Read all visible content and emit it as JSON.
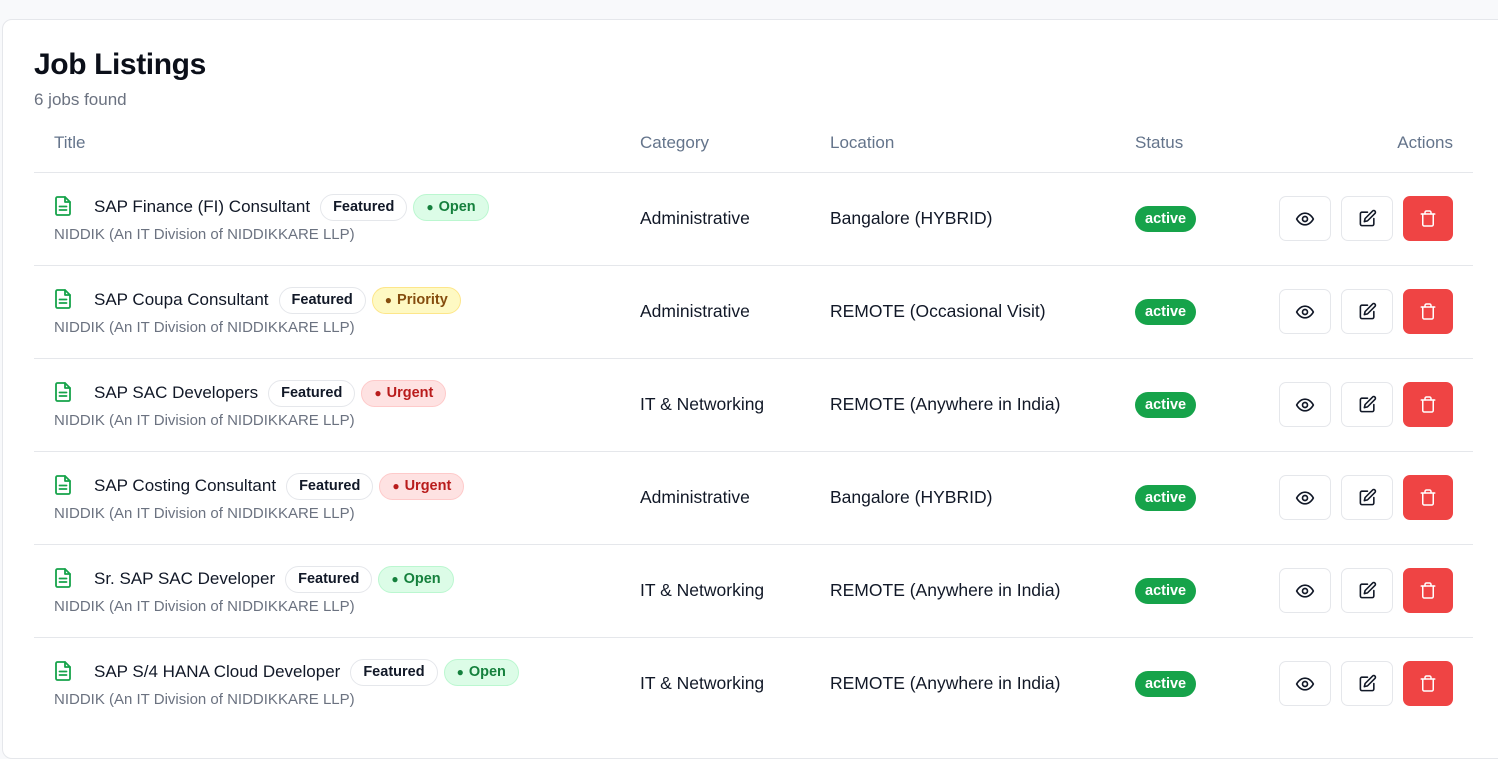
{
  "header": {
    "title": "Job Listings",
    "subtitle": "6 jobs found"
  },
  "columns": {
    "title": "Title",
    "category": "Category",
    "location": "Location",
    "status": "Status",
    "actions": "Actions"
  },
  "colors": {
    "status_active": "#16a34a",
    "delete_button": "#ef4444",
    "doc_icon": "#16a34a"
  },
  "jobs": [
    {
      "title": "SAP Finance (FI) Consultant",
      "featured": "Featured",
      "tag": {
        "label": "Open",
        "kind": "open"
      },
      "company": "NIDDIK (An IT Division of NIDDIKKARE LLP)",
      "category": "Administrative",
      "location": "Bangalore (HYBRID)",
      "status": "active"
    },
    {
      "title": "SAP Coupa Consultant",
      "featured": "Featured",
      "tag": {
        "label": "Priority",
        "kind": "priority"
      },
      "company": "NIDDIK (An IT Division of NIDDIKKARE LLP)",
      "category": "Administrative",
      "location": "REMOTE (Occasional Visit)",
      "status": "active"
    },
    {
      "title": "SAP SAC Developers",
      "featured": "Featured",
      "tag": {
        "label": "Urgent",
        "kind": "urgent"
      },
      "company": "NIDDIK (An IT Division of NIDDIKKARE LLP)",
      "category": "IT & Networking",
      "location": "REMOTE (Anywhere in India)",
      "status": "active"
    },
    {
      "title": "SAP Costing Consultant",
      "featured": "Featured",
      "tag": {
        "label": "Urgent",
        "kind": "urgent"
      },
      "company": "NIDDIK (An IT Division of NIDDIKKARE LLP)",
      "category": "Administrative",
      "location": "Bangalore (HYBRID)",
      "status": "active"
    },
    {
      "title": "Sr. SAP SAC Developer",
      "featured": "Featured",
      "tag": {
        "label": "Open",
        "kind": "open"
      },
      "company": "NIDDIK (An IT Division of NIDDIKKARE LLP)",
      "category": "IT & Networking",
      "location": "REMOTE (Anywhere in India)",
      "status": "active"
    },
    {
      "title": "SAP S/4 HANA Cloud Developer",
      "featured": "Featured",
      "tag": {
        "label": "Open",
        "kind": "open"
      },
      "company": "NIDDIK (An IT Division of NIDDIKKARE LLP)",
      "category": "IT & Networking",
      "location": "REMOTE (Anywhere in India)",
      "status": "active"
    }
  ],
  "icons": {
    "row": "document-icon",
    "view": "eye-icon",
    "edit": "edit-icon",
    "delete": "trash-icon"
  }
}
